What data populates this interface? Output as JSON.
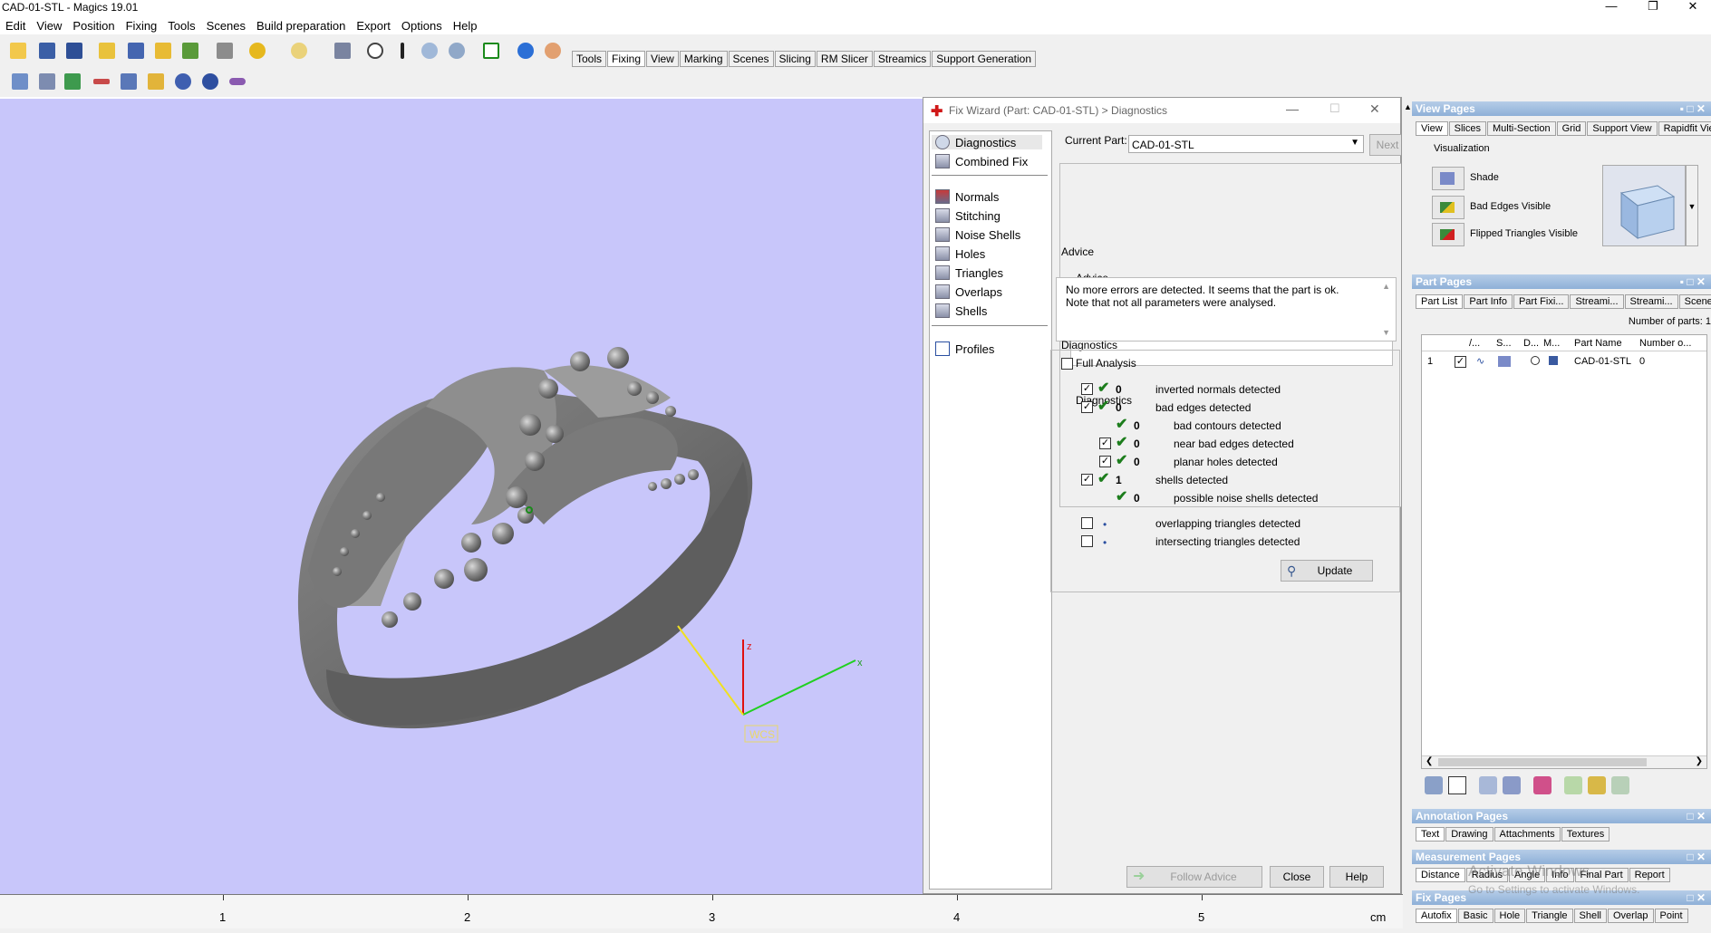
{
  "app": {
    "title": "CAD-01-STL - Magics 19.01"
  },
  "menu": [
    "Edit",
    "View",
    "Position",
    "Fixing",
    "Tools",
    "Scenes",
    "Build preparation",
    "Export",
    "Options",
    "Help"
  ],
  "toolbar_tabs": [
    "Tools",
    "Fixing",
    "View",
    "Marking",
    "Scenes",
    "Slicing",
    "RM Slicer",
    "Streamics",
    "Support Generation"
  ],
  "active_toolbar_tab": "Fixing",
  "viewport": {
    "axis_x": "x",
    "axis_z": "z",
    "wcs": "WCS",
    "background": "#c8c6fa"
  },
  "ruler": {
    "labels": [
      "1",
      "2",
      "3",
      "4",
      "5"
    ],
    "unit": "cm"
  },
  "fix_wizard": {
    "title": "Fix Wizard (Part: CAD-01-STL) > Diagnostics",
    "nav": [
      "Diagnostics",
      "Combined Fix",
      "Normals",
      "Stitching",
      "Noise Shells",
      "Holes",
      "Triangles",
      "Overlaps",
      "Shells",
      "Profiles"
    ],
    "current_part_label": "Current Part:",
    "current_part_value": "CAD-01-STL",
    "next": "Next",
    "advice_label": "Advice",
    "advice_text": "No more errors are detected. It seems that the part is ok. Note that not all parameters were analysed.",
    "diagnostics_label": "Diagnostics",
    "full_analysis": "Full Analysis",
    "rows": [
      {
        "count": "0",
        "label": "inverted normals detected"
      },
      {
        "count": "0",
        "label": "bad edges detected"
      },
      {
        "count": "0",
        "label": "bad contours detected"
      },
      {
        "count": "0",
        "label": "near bad edges detected"
      },
      {
        "count": "0",
        "label": "planar holes detected"
      },
      {
        "count": "1",
        "label": "shells detected"
      },
      {
        "count": "0",
        "label": "possible noise shells detected"
      },
      {
        "count": "",
        "label": "overlapping triangles detected"
      },
      {
        "count": "",
        "label": "intersecting triangles detected"
      }
    ],
    "update": "Update",
    "follow_advice": "Follow Advice",
    "close": "Close",
    "help": "Help"
  },
  "view_pages": {
    "title": "View Pages",
    "tabs": [
      "View",
      "Slices",
      "Multi-Section",
      "Grid",
      "Support View",
      "Rapidfit View"
    ],
    "visualization": "Visualization",
    "items": [
      "Shade",
      "Bad Edges Visible",
      "Flipped Triangles Visible"
    ]
  },
  "part_pages": {
    "title": "Part Pages",
    "tabs": [
      "Part List",
      "Part Info",
      "Part Fixi...",
      "Streami...",
      "Streami...",
      "Scenes"
    ],
    "number_of_parts": "Number of parts: 1",
    "columns": [
      "/...",
      "S...",
      "D...",
      "M...",
      "Part Name",
      "Number o..."
    ],
    "row": {
      "index": "1",
      "name": "CAD-01-STL",
      "number": "0"
    }
  },
  "annotation_pages": {
    "title": "Annotation Pages",
    "tabs": [
      "Text",
      "Drawing",
      "Attachments",
      "Textures"
    ]
  },
  "measurement_pages": {
    "title": "Measurement Pages",
    "tabs": [
      "Distance",
      "Radius",
      "Angle",
      "Info",
      "Final Part",
      "Report"
    ]
  },
  "fix_pages": {
    "title": "Fix Pages",
    "tabs": [
      "Autofix",
      "Basic",
      "Hole",
      "Triangle",
      "Shell",
      "Overlap",
      "Point"
    ]
  },
  "watermark": {
    "line1": "Activate Windows",
    "line2": "Go to Settings to activate Windows."
  }
}
